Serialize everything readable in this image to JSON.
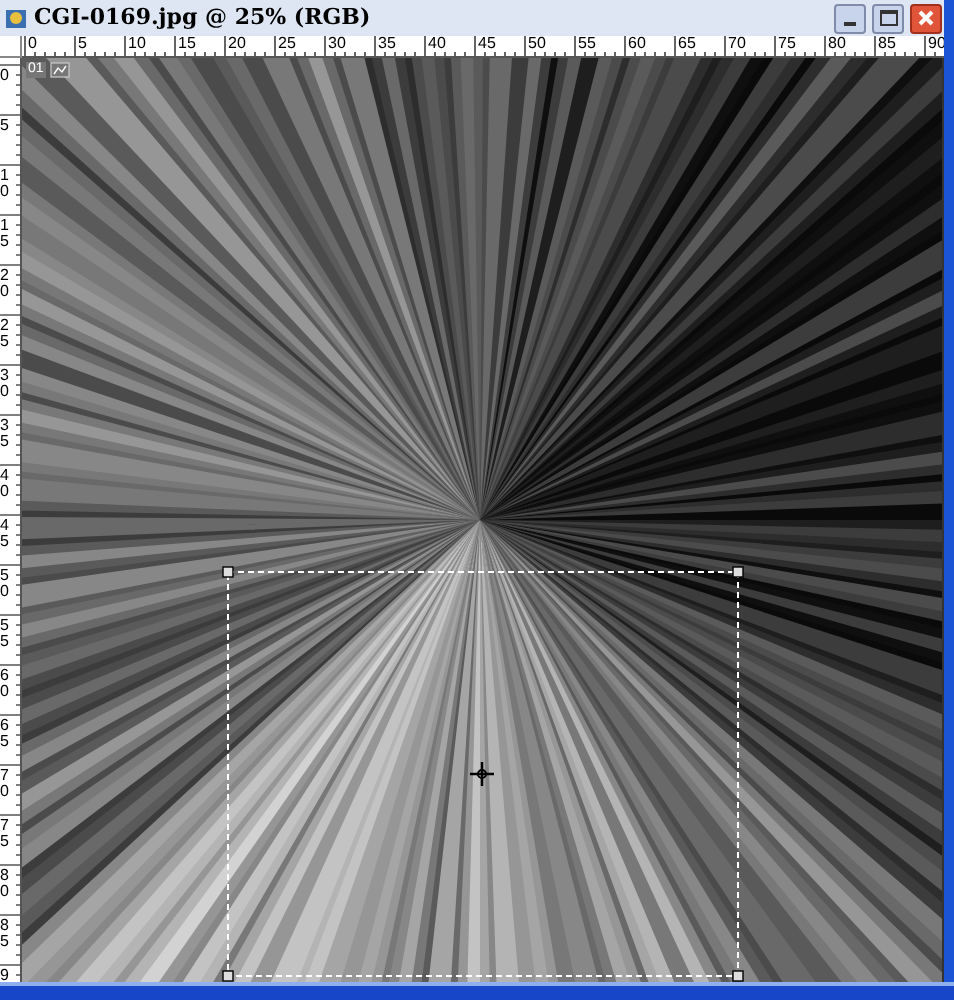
{
  "window": {
    "title": "CGI-0169.jpg @ 25% (RGB)"
  },
  "ruler_top": {
    "labels": [
      "0",
      "5",
      "10",
      "15",
      "20",
      "25",
      "30",
      "35",
      "40",
      "45",
      "50",
      "55",
      "60",
      "65",
      "70",
      "75",
      "80",
      "85",
      "90"
    ]
  },
  "ruler_left": {
    "labels": [
      "0",
      "5",
      "10",
      "15",
      "20",
      "25",
      "30",
      "35",
      "40",
      "45",
      "50",
      "55",
      "60",
      "65",
      "70",
      "75",
      "80",
      "85",
      "9"
    ]
  },
  "canvas": {
    "badge": "01"
  }
}
